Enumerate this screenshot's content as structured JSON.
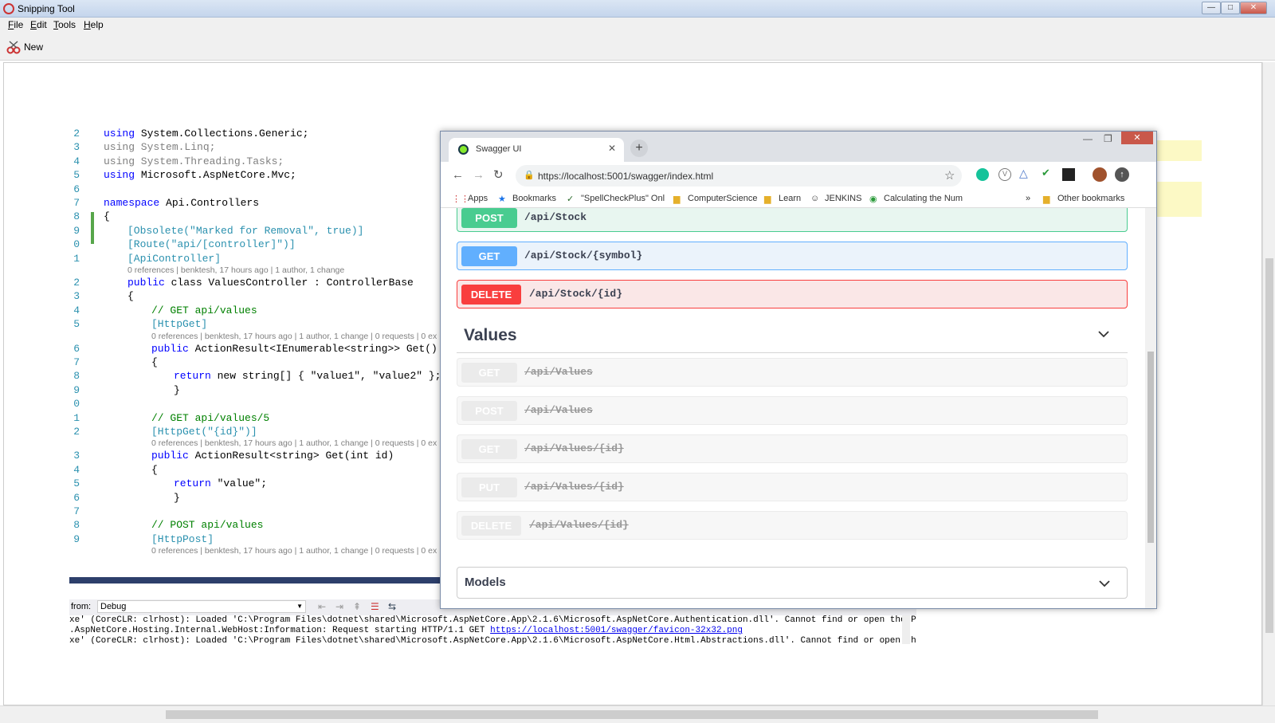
{
  "window": {
    "title": "Snipping Tool"
  },
  "menu": [
    {
      "label": "File",
      "u": "F",
      "rest": "ile"
    },
    {
      "label": "Edit",
      "u": "E",
      "rest": "dit"
    },
    {
      "label": "Tools",
      "u": "T",
      "rest": "ools"
    },
    {
      "label": "Help",
      "u": "H",
      "rest": "elp"
    }
  ],
  "toolbar": {
    "new_label": "New"
  },
  "editor": {
    "lines": [
      {
        "n": "2",
        "text": "using System.Collections.Generic;"
      },
      {
        "n": "3",
        "text": "using System.Linq;"
      },
      {
        "n": "4",
        "text": "using System.Threading.Tasks;"
      },
      {
        "n": "5",
        "text": "using Microsoft.AspNetCore.Mvc;"
      },
      {
        "n": "6",
        "text": ""
      },
      {
        "n": "7",
        "text": "namespace Api.Controllers"
      },
      {
        "n": "8",
        "text": "{"
      },
      {
        "n": "9",
        "text": "[Obsolete(\"Marked for Removal\", true)]"
      },
      {
        "n": "0",
        "text": "[Route(\"api/[controller]\")]"
      },
      {
        "n": "1",
        "text": "[ApiController]"
      },
      {
        "n": "2",
        "text": "public class ValuesController : ControllerBase"
      },
      {
        "n": "3",
        "text": "{"
      },
      {
        "n": "4",
        "text": "// GET api/values"
      },
      {
        "n": "5",
        "text": "[HttpGet]"
      },
      {
        "n": "6",
        "text": "public ActionResult<IEnumerable<string>> Get()"
      },
      {
        "n": "7",
        "text": "{"
      },
      {
        "n": "8",
        "text": "return new string[] { \"value1\", \"value2\" };"
      },
      {
        "n": "9",
        "text": "}"
      },
      {
        "n": "0",
        "text": ""
      },
      {
        "n": "1",
        "text": "// GET api/values/5"
      },
      {
        "n": "2",
        "text": "[HttpGet(\"{id}\")]"
      },
      {
        "n": "3",
        "text": "public ActionResult<string> Get(int id)"
      },
      {
        "n": "4",
        "text": "{"
      },
      {
        "n": "5",
        "text": "return \"value\";"
      },
      {
        "n": "6",
        "text": "}"
      },
      {
        "n": "7",
        "text": ""
      },
      {
        "n": "8",
        "text": "// POST api/values"
      },
      {
        "n": "9",
        "text": "[HttpPost]"
      }
    ],
    "lens_class": "0 references | benktesh, 17 hours ago | 1 author, 1 change",
    "lens_get": "0 references | benktesh, 17 hours ago | 1 author, 1 change | 0 requests | 0 ex",
    "lens_getid": "0 references | benktesh, 17 hours ago | 1 author, 1 change | 0 requests | 0 ex",
    "lens_post": "0 references | benktesh, 17 hours ago | 1 author, 1 change | 0 requests | 0 ex"
  },
  "output": {
    "from_label": "from:",
    "source": "Debug",
    "lines": [
      "xe' (CoreCLR: clrhost): Loaded 'C:\\Program Files\\dotnet\\shared\\Microsoft.AspNetCore.App\\2.1.6\\Microsoft.AspNetCore.Authentication.dll'. Cannot find or open the PDB file.",
      ".AspNetCore.Hosting.Internal.WebHost:Information: Request starting HTTP/1.1 GET ",
      "xe' (CoreCLR: clrhost): Loaded 'C:\\Program Files\\dotnet\\shared\\Microsoft.AspNetCore.App\\2.1.6\\Microsoft.AspNetCore.Html.Abstractions.dll'. Cannot find or open the PDB fi"
    ],
    "link": "https://localhost:5001/swagger/favicon-32x32.png"
  },
  "browser": {
    "tab_title": "Swagger UI",
    "url": "https://localhost:5001/swagger/index.html",
    "bookmarks": [
      "Apps",
      "Bookmarks",
      "\"SpellCheckPlus\" Onl",
      "ComputerScience",
      "Learn",
      "JENKINS",
      "Calculating the Num"
    ],
    "other_bookmarks": "Other bookmarks",
    "more": "»"
  },
  "swagger": {
    "ops_top": [
      {
        "method": "POST",
        "path": "/api/Stock",
        "color": "#49cc90",
        "bg": "#e8f6f0",
        "border": "#49cc90"
      },
      {
        "method": "GET",
        "path": "/api/Stock/{symbol}",
        "color": "#61affe",
        "bg": "#ebf3fb",
        "border": "#61affe"
      },
      {
        "method": "DELETE",
        "path": "/api/Stock/{id}",
        "color": "#f93e3e",
        "bg": "#fae7e7",
        "border": "#f93e3e"
      }
    ],
    "section_title": "Values",
    "ops_deprecated": [
      {
        "method": "GET",
        "path": "/api/Values"
      },
      {
        "method": "POST",
        "path": "/api/Values"
      },
      {
        "method": "GET",
        "path": "/api/Values/{id}"
      },
      {
        "method": "PUT",
        "path": "/api/Values/{id}"
      },
      {
        "method": "DELETE",
        "path": "/api/Values/{id}"
      }
    ],
    "models_title": "Models"
  }
}
